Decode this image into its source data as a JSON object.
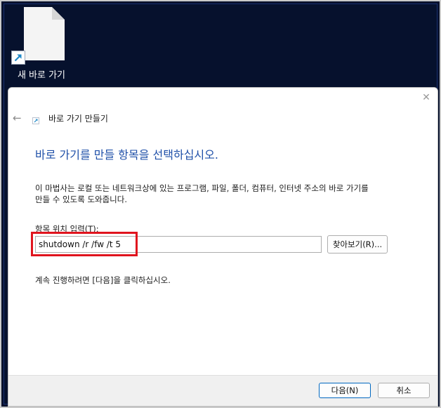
{
  "desktop": {
    "icon_label": "새 바로 가기"
  },
  "dialog": {
    "close_glyph": "✕",
    "back_glyph": "←",
    "wizard_title": "바로 가기 만들기",
    "heading": "바로 가기를 만들 항목을 선택하십시오.",
    "description_line1": "이 마법사는 로컬 또는 네트워크상에 있는 프로그램, 파일, 폴더, 컴퓨터, 인터넷 주소의 바로 가기를",
    "description_line2": "만들 수 있도록 도와줍니다.",
    "location_label": "항목 위치 입력(T):",
    "location_value": "shutdown /r /fw /t 5",
    "browse_label": "찾아보기(R)...",
    "hint": "계속 진행하려면 [다음]을 클릭하십시오.",
    "next_label": "다음(N)",
    "cancel_label": "취소"
  },
  "colors": {
    "desktop_bg": "#06112d",
    "heading": "#1e4fa8",
    "highlight": "#e0141e",
    "shortcut_arrow": "#1e88c8"
  }
}
